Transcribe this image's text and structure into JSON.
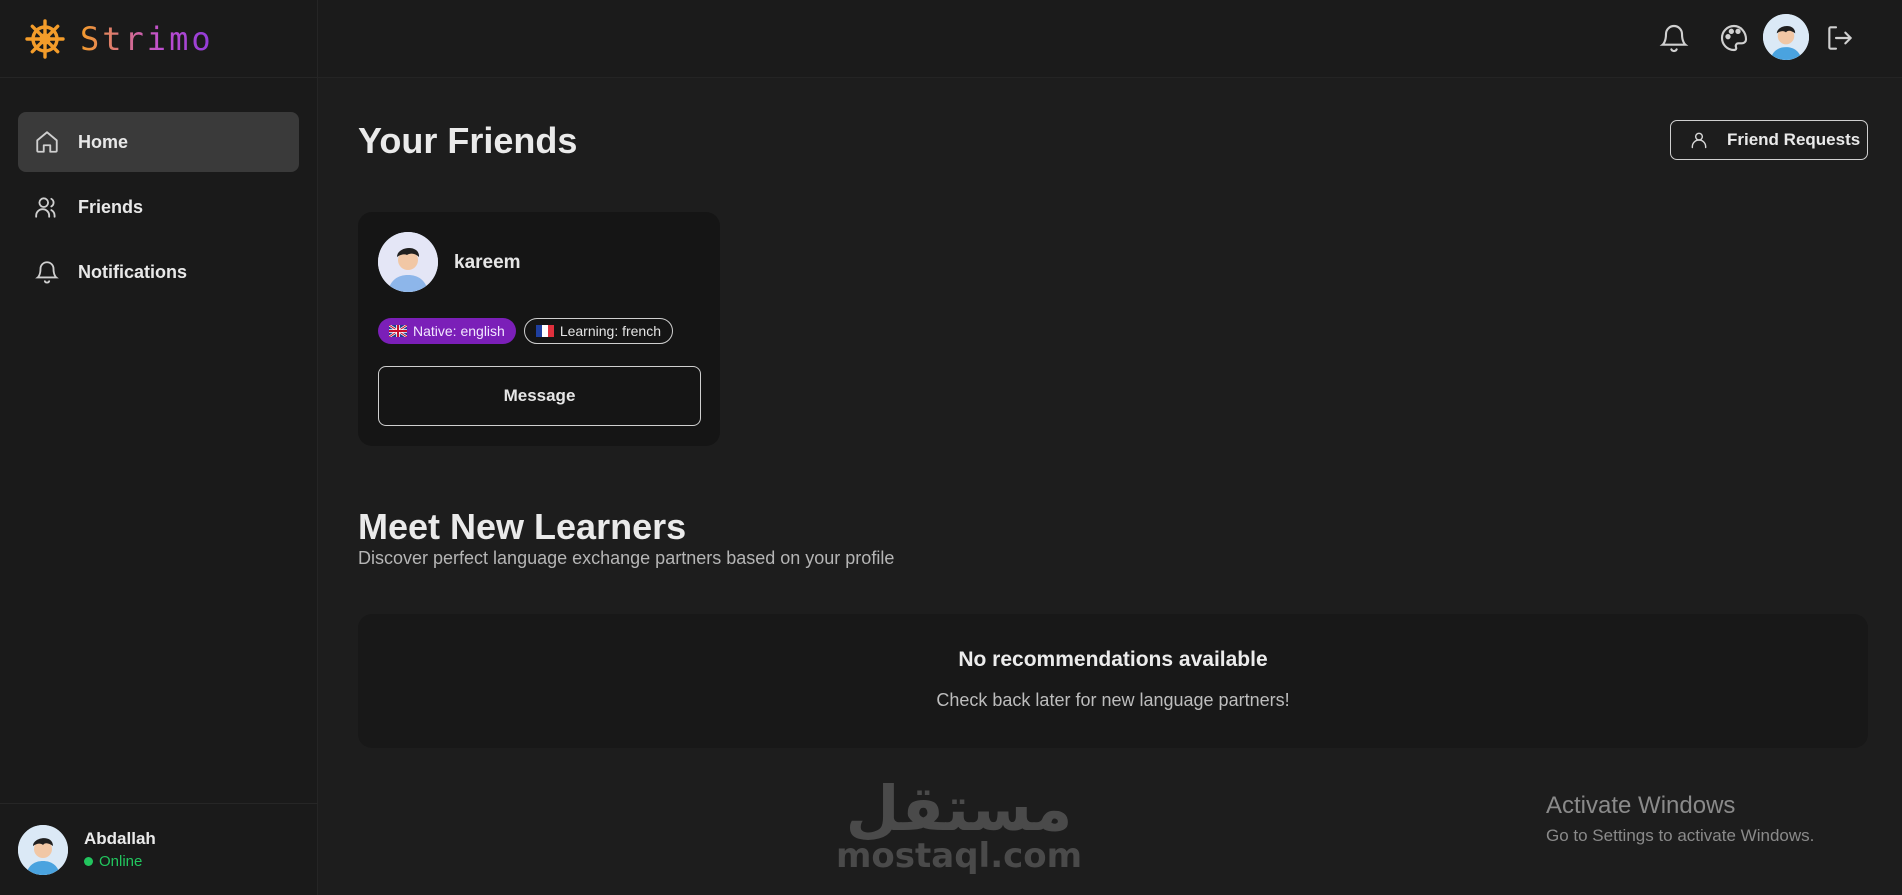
{
  "brand": {
    "name": "Strimo",
    "icon": "ship-wheel-icon",
    "colors": {
      "start": "#f39c2a",
      "end": "#8e3ad8"
    }
  },
  "sidebar": {
    "items": [
      {
        "label": "Home",
        "icon": "home-icon",
        "active": true
      },
      {
        "label": "Friends",
        "icon": "users-icon",
        "active": false
      },
      {
        "label": "Notifications",
        "icon": "bell-icon",
        "active": false
      }
    ],
    "user": {
      "name": "Abdallah",
      "status": "Online"
    }
  },
  "topbar": {
    "icons": [
      "bell-icon",
      "palette-icon",
      "avatar",
      "logout-icon"
    ]
  },
  "friends": {
    "title": "Your Friends",
    "requests_label": "Friend Requests",
    "cards": [
      {
        "name": "kareem",
        "native": "Native: english",
        "learning": "Learning: french",
        "message_label": "Message"
      }
    ]
  },
  "recommendations": {
    "title": "Meet New Learners",
    "subtitle": "Discover perfect language exchange partners based on your profile",
    "empty_title": "No recommendations available",
    "empty_subtitle": "Check back later for new language partners!"
  },
  "watermark": {
    "arabic": "مستقل",
    "latin": "mostaql.com"
  },
  "os_notice": {
    "title": "Activate Windows",
    "subtitle": "Go to Settings to activate Windows."
  },
  "colors": {
    "accent": "#7b1fb8",
    "online": "#22c55e",
    "background": "#1d1d1d"
  }
}
